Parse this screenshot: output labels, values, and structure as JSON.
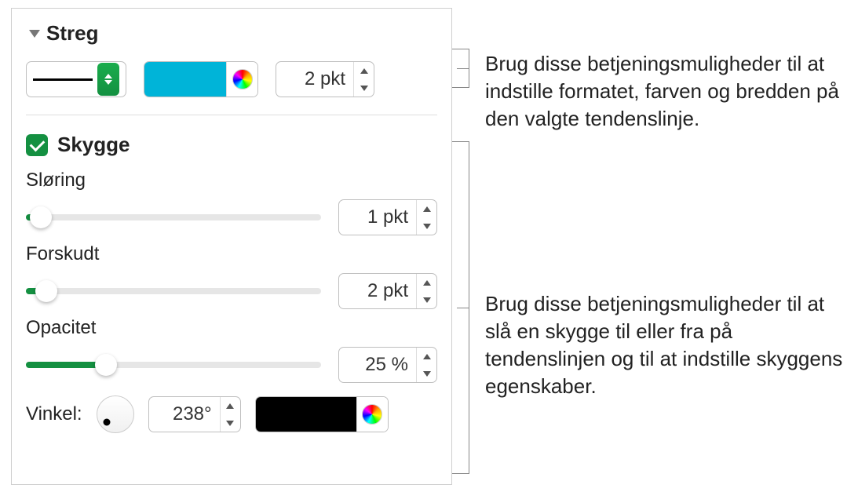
{
  "stroke": {
    "title": "Streg",
    "width_value": "2 pkt",
    "color": "#00b4d8"
  },
  "shadow": {
    "label": "Skygge",
    "blur": {
      "label": "Sløring",
      "value": "1 pkt",
      "slider_pct": 5
    },
    "offset": {
      "label": "Forskudt",
      "value": "2 pkt",
      "slider_pct": 7
    },
    "opacity": {
      "label": "Opacitet",
      "value": "25 %",
      "slider_pct": 27
    },
    "angle": {
      "label": "Vinkel:",
      "value": "238°"
    },
    "color": "#000000"
  },
  "callouts": {
    "c1": "Brug disse betjeningsmuligheder til at indstille formatet, farven og bredden på den valgte tendenslinje.",
    "c2": "Brug disse betjeningsmuligheder til at slå en skygge til eller fra på tendenslinjen og til at indstille skyggens egenskaber."
  }
}
